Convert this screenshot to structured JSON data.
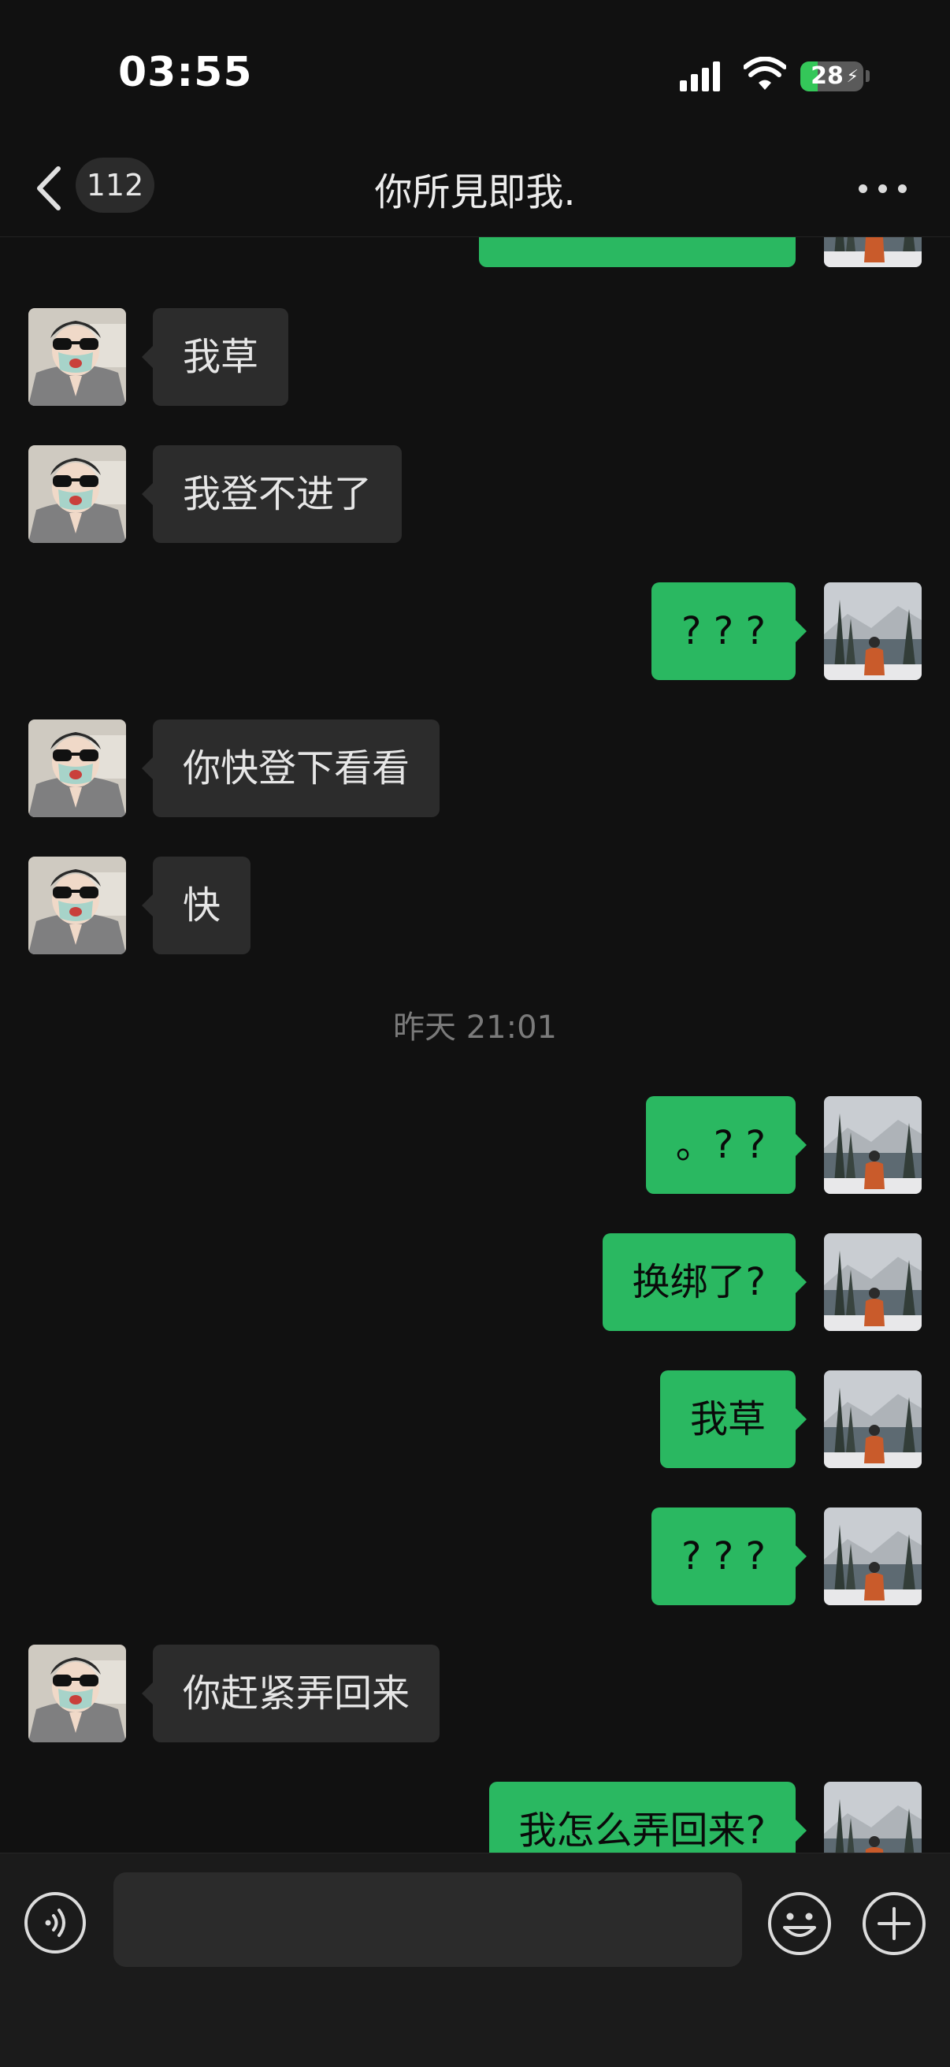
{
  "status_bar": {
    "time": "03:55",
    "battery": "28",
    "battery_level": 0.28
  },
  "header": {
    "back_count": "112",
    "title": "你所見即我."
  },
  "messages": [
    {
      "dir": "in",
      "text": "我草"
    },
    {
      "dir": "in",
      "text": "我登不进了"
    },
    {
      "dir": "out",
      "text": "? ? ?"
    },
    {
      "dir": "in",
      "text": "你快登下看看"
    },
    {
      "dir": "in",
      "text": "快"
    },
    {
      "timestamp": "昨天 21:01"
    },
    {
      "dir": "out",
      "text": "。? ?"
    },
    {
      "dir": "out",
      "text": "换绑了?"
    },
    {
      "dir": "out",
      "text": "我草"
    },
    {
      "dir": "out",
      "text": "? ? ?"
    },
    {
      "dir": "in",
      "text": "你赶紧弄回来"
    },
    {
      "dir": "out",
      "text": "我怎么弄回来?"
    }
  ],
  "input": {
    "placeholder": ""
  },
  "colors": {
    "background": "#111111",
    "outgoing_bubble": "#2ab861",
    "incoming_bubble": "#2c2c2c"
  }
}
